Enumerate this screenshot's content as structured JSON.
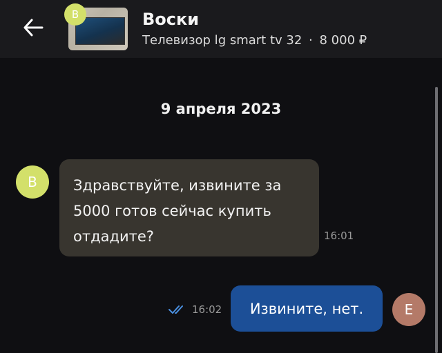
{
  "header": {
    "back_icon": "arrow-left-icon",
    "seller_initial": "В",
    "seller_name": "Воски",
    "listing_title": "Телевизор lg smart tv 32",
    "separator": "·",
    "listing_price": "8 000 ₽"
  },
  "chat": {
    "date": "9 апреля 2023",
    "messages": [
      {
        "direction": "incoming",
        "avatar_initial": "В",
        "lines": [
          "Здравствуйте, извините за",
          "5000 готов сейчас купить",
          "отдадите?"
        ],
        "time": "16:01"
      },
      {
        "direction": "outgoing",
        "avatar_initial": "Е",
        "text": "Извините, нет.",
        "time": "16:02",
        "status_icon": "double-check-icon"
      }
    ]
  },
  "colors": {
    "background": "#0f0f12",
    "header_bg": "#1a1a1d",
    "incoming_bubble": "#38352f",
    "outgoing_bubble": "#1c4f97",
    "seller_avatar": "#d3e06a",
    "user_avatar": "#b47a68",
    "read_check": "#4a90e2"
  }
}
